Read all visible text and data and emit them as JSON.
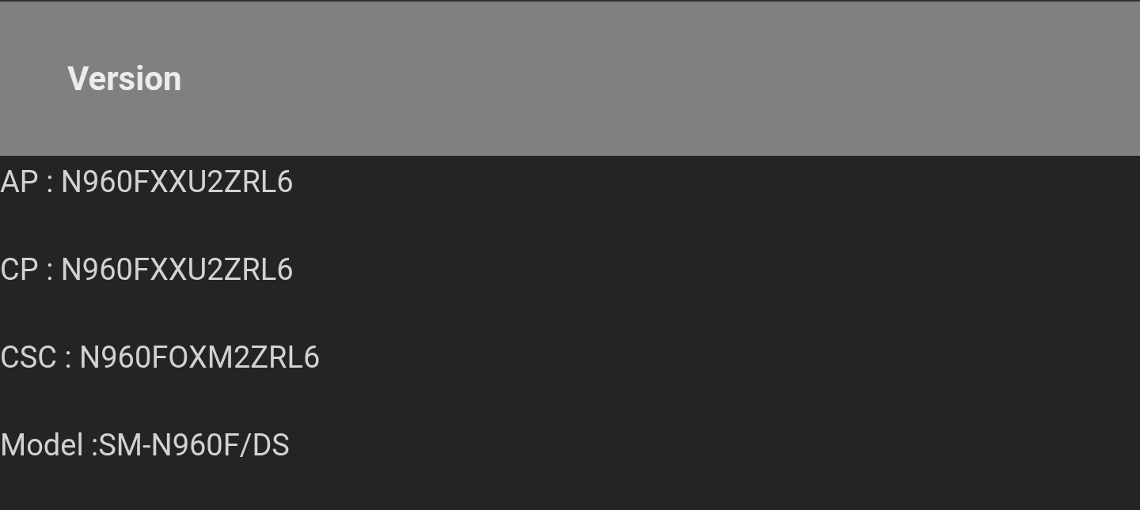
{
  "header": {
    "title": "Version"
  },
  "lines": [
    "AP : N960FXXU2ZRL6",
    "CP : N960FXXU2ZRL6",
    "CSC : N960FOXM2ZRL6",
    "Model :SM-N960F/DS"
  ]
}
